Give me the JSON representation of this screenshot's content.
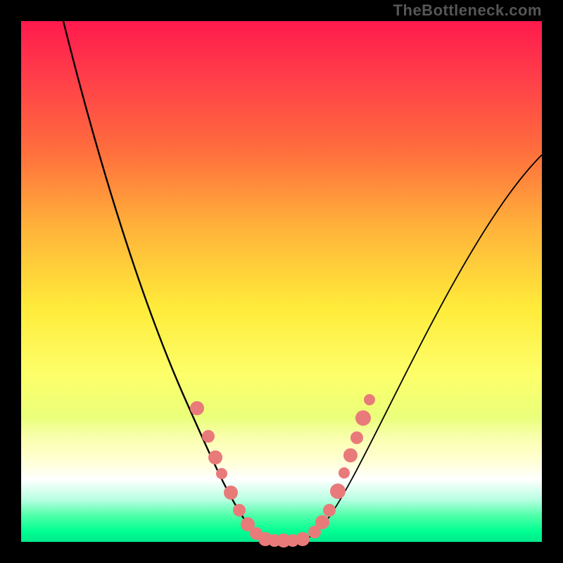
{
  "attribution": "TheBottleneck.com",
  "chart_data": {
    "type": "line",
    "title": "",
    "xlabel": "",
    "ylabel": "",
    "xlim": [
      0,
      100
    ],
    "ylim": [
      0,
      100
    ],
    "series": [
      {
        "name": "bottleneck-curve",
        "x": [
          8,
          15,
          22,
          28,
          33,
          36,
          38,
          40,
          42,
          45,
          48,
          52,
          55,
          57,
          59,
          62,
          68,
          76,
          86,
          98
        ],
        "y": [
          100,
          80,
          58,
          40,
          26,
          18,
          12,
          6,
          2,
          0,
          0,
          0,
          2,
          6,
          12,
          20,
          32,
          45,
          56,
          66
        ]
      }
    ],
    "markers": {
      "name": "highlighted-points",
      "color": "#e97a7a",
      "points_xy": [
        [
          33,
          26
        ],
        [
          35,
          20
        ],
        [
          36,
          16
        ],
        [
          38,
          12
        ],
        [
          40,
          8
        ],
        [
          41,
          5
        ],
        [
          43,
          2
        ],
        [
          45,
          0
        ],
        [
          46,
          0
        ],
        [
          48,
          0
        ],
        [
          50,
          0
        ],
        [
          52,
          0
        ],
        [
          54,
          1
        ],
        [
          56,
          4
        ],
        [
          57,
          7
        ],
        [
          58,
          10
        ],
        [
          59,
          14
        ],
        [
          60,
          18
        ],
        [
          61,
          22
        ],
        [
          62,
          27
        ]
      ]
    },
    "background": {
      "type": "gradient",
      "direction": "vertical",
      "stops": [
        {
          "pos": 0,
          "color": "#ff1a4d"
        },
        {
          "pos": 55,
          "color": "#ffeb3a"
        },
        {
          "pos": 88,
          "color": "#ffffff"
        },
        {
          "pos": 100,
          "color": "#00e98c"
        }
      ]
    }
  }
}
